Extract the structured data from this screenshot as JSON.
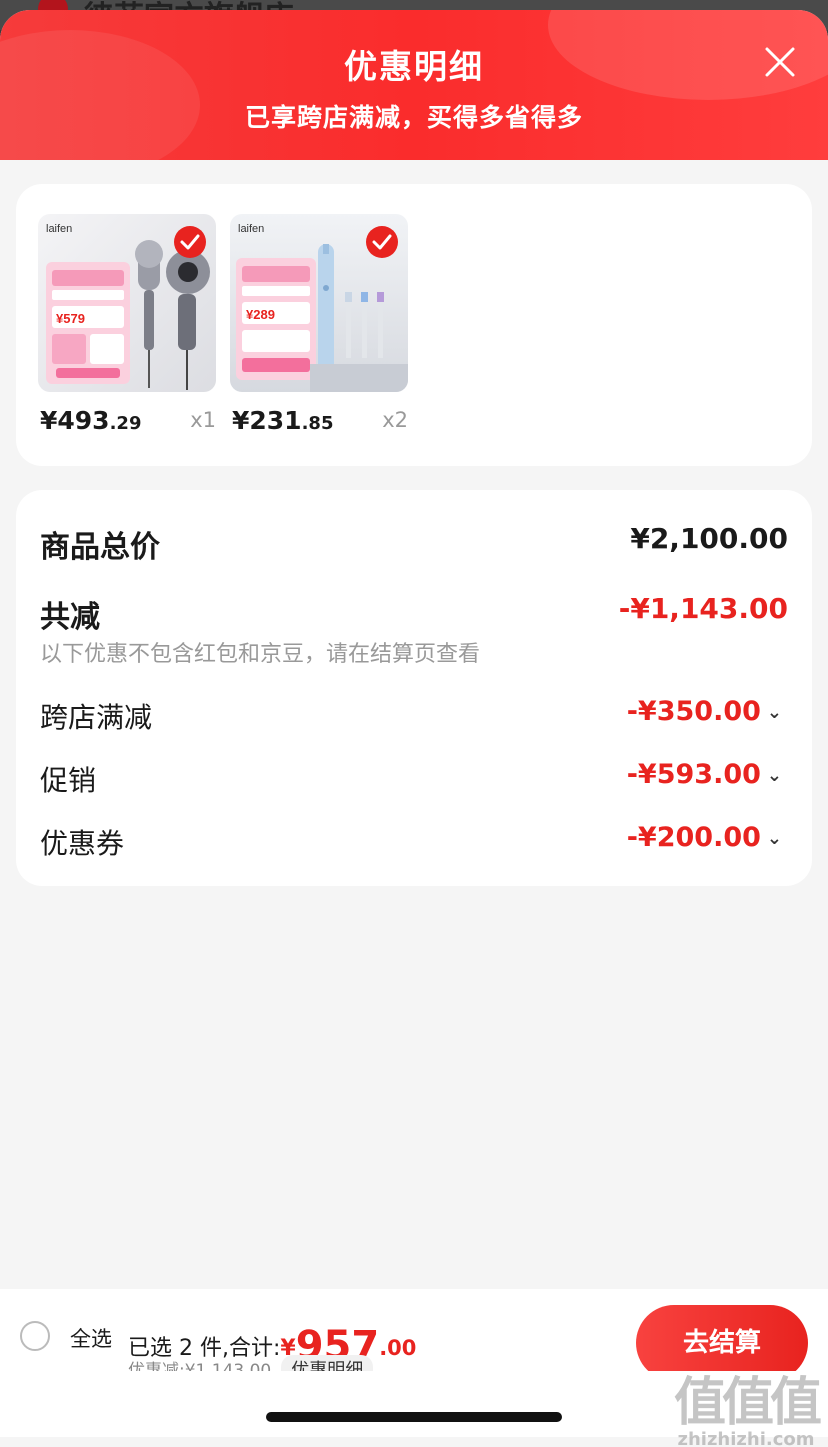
{
  "background": {
    "store_name": "徕芬官方旗舰店 ›"
  },
  "sheet": {
    "title": "优惠明细",
    "subtitle": "已享跨店满减，买得多省得多"
  },
  "products": [
    {
      "brand": "laifen",
      "promo_price": "¥579",
      "price_main": "¥493",
      "price_cents": ".29",
      "qty": "x1",
      "selected": true,
      "icon": "hair-dryer-icon"
    },
    {
      "brand": "laifen",
      "promo_price": "¥289",
      "price_main": "¥231",
      "price_cents": ".85",
      "qty": "x2",
      "selected": true,
      "icon": "toothbrush-icon"
    }
  ],
  "summary": {
    "total_label": "商品总价",
    "total_value": "¥2,100.00",
    "reduce_label": "共减",
    "reduce_value": "-¥1,143.00",
    "note": "以下优惠不包含红包和京豆，请在结算页查看",
    "items": [
      {
        "label": "跨店满减",
        "value": "-¥350.00"
      },
      {
        "label": "促销",
        "value": "-¥593.00"
      },
      {
        "label": "优惠券",
        "value": "-¥200.00"
      }
    ]
  },
  "bottom_bar": {
    "select_all": "全选",
    "selected_prefix": "已选 2 件,合计:",
    "total_yen": "¥",
    "total_int": "957",
    "total_dec": ".00",
    "discount_text": "优惠减:¥1,143.00",
    "detail_chip": "优惠明细",
    "checkout": "去结算"
  },
  "watermark": {
    "big": "值值值",
    "small": "zhizhizhi.com"
  },
  "colors": {
    "accent_red": "#e8231f",
    "header_red": "#fa2c2c",
    "page_bg": "#f5f5f5"
  }
}
